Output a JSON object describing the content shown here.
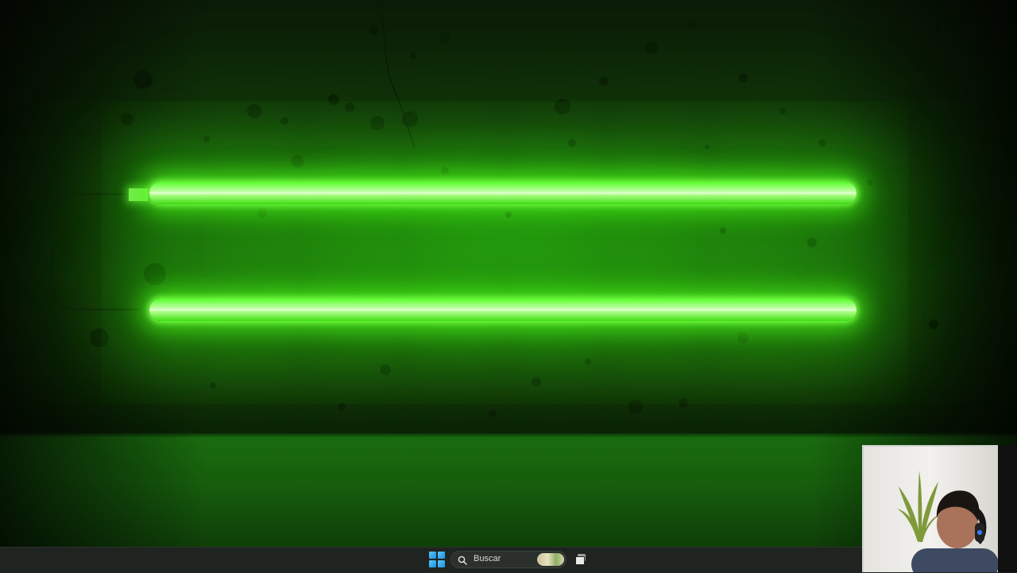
{
  "wallpaper": {
    "description_color_primary": "#39ff14",
    "glow_color": "#58ff2a",
    "tube_count": 2
  },
  "taskbar": {
    "start_icon": "windows-logo-icon",
    "search": {
      "icon": "search-icon",
      "placeholder": "Buscar"
    },
    "task_view_icon": "task-view-icon",
    "background_color": "#1f2420"
  },
  "webcam_overlay": {
    "visible": true
  }
}
